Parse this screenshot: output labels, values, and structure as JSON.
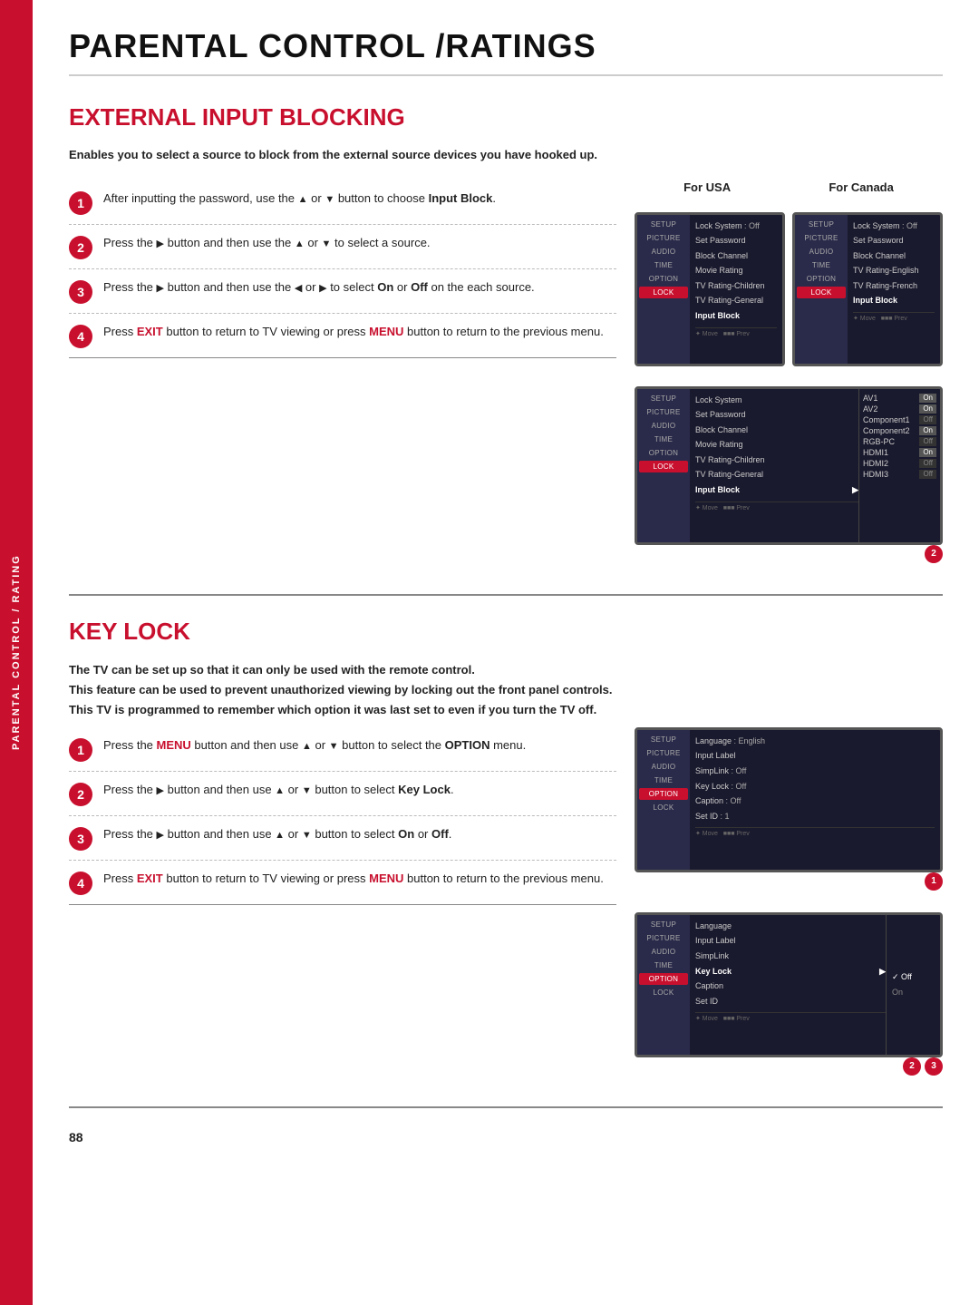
{
  "page": {
    "title": "PARENTAL CONTROL /RATINGS",
    "page_number": "88"
  },
  "side_tab": {
    "label": "PARENTAL CONTROL / RATING"
  },
  "section1": {
    "title": "EXTERNAL INPUT BLOCKING",
    "intro": "Enables you to select a source to block from the external source devices you have hooked up.",
    "steps": [
      {
        "num": "1",
        "text": "After inputting the password, use the ▲ or ▼ button to choose ",
        "bold": "Input Block",
        "text2": "."
      },
      {
        "num": "2",
        "text": "Press the ▶ button and then use the ▲ or ▼ to select a source."
      },
      {
        "num": "3",
        "text": "Press the ▶ button and then use the ◀ or ▶ to select ",
        "bold1": "On",
        "text_mid": " or ",
        "bold2": "Off",
        "text2": " on the each source."
      },
      {
        "num": "4",
        "text": "Press ",
        "bold1": "EXIT",
        "text_mid": " button to return to TV viewing or press ",
        "bold2": "MENU",
        "text2": " button to return to the previous menu."
      }
    ],
    "for_usa_label": "For USA",
    "for_canada_label": "For Canada",
    "screen1_usa": {
      "sidebar": [
        "SETUP",
        "PICTURE",
        "AUDIO",
        "TIME",
        "OPTION",
        "LOCK"
      ],
      "menu_items": [
        {
          "label": "Lock System",
          "val": ": Off"
        },
        {
          "label": "Set Password"
        },
        {
          "label": "Block Channel"
        },
        {
          "label": "Movie Rating"
        },
        {
          "label": "TV Rating-Children"
        },
        {
          "label": "TV Rating-General"
        },
        {
          "label": "Input Block",
          "highlighted": true
        }
      ]
    },
    "screen1_canada": {
      "sidebar": [
        "SETUP",
        "PICTURE",
        "AUDIO",
        "TIME",
        "OPTION",
        "LOCK"
      ],
      "menu_items": [
        {
          "label": "Lock System",
          "val": ": Off"
        },
        {
          "label": "Set Password"
        },
        {
          "label": "Block Channel"
        },
        {
          "label": "TV Rating-English"
        },
        {
          "label": "TV Rating-French"
        },
        {
          "label": "Input Block",
          "highlighted": true
        }
      ]
    },
    "screen2": {
      "sidebar": [
        "SETUP",
        "PICTURE",
        "AUDIO",
        "TIME",
        "OPTION",
        "LOCK"
      ],
      "menu_items": [
        {
          "label": "Lock System"
        },
        {
          "label": "Set Password"
        },
        {
          "label": "Block Channel"
        },
        {
          "label": "Movie Rating"
        },
        {
          "label": "TV Rating-Children"
        },
        {
          "label": "TV Rating-General"
        },
        {
          "label": "Input Block",
          "highlighted": true,
          "arrow": true
        }
      ],
      "sub_items": [
        {
          "label": "AV1",
          "val": "On"
        },
        {
          "label": "AV2",
          "val": "On"
        },
        {
          "label": "Component1",
          "val": "Off"
        },
        {
          "label": "Component2",
          "val": "On"
        },
        {
          "label": "RGB-PC",
          "val": "Off"
        },
        {
          "label": "HDMI1",
          "val": "On"
        },
        {
          "label": "HDMI2",
          "val": "Off"
        },
        {
          "label": "HDMI3",
          "val": "Off"
        }
      ]
    },
    "badge1": "2"
  },
  "section2": {
    "title": "KEY LOCK",
    "intro_lines": [
      "The TV can be set up so that it can only be used with the remote control.",
      "This feature can be used to prevent unauthorized viewing by locking out the front panel controls.",
      "This TV is programmed to remember which option it was last set to even if you turn the TV off."
    ],
    "steps": [
      {
        "num": "1",
        "text": "Press the ",
        "bold1": "MENU",
        "text_mid": " button and then use ▲ or ▼ button to select the ",
        "bold2": "OPTION",
        "text2": " menu."
      },
      {
        "num": "2",
        "text": "Press the ▶ button and then use ▲ or ▼ button to select ",
        "bold": "Key Lock",
        "text2": "."
      },
      {
        "num": "3",
        "text": "Press the ▶ button and then use ▲ or ▼ button to select ",
        "bold1": "On",
        "text_mid": " or ",
        "bold2": "Off",
        "text2": "."
      },
      {
        "num": "4",
        "text": "Press ",
        "bold1": "EXIT",
        "text_mid": " button to return to TV viewing or press ",
        "bold2": "MENU",
        "text2": " button to return to the previous menu."
      }
    ],
    "screen_option": {
      "sidebar": [
        "SETUP",
        "PICTURE",
        "AUDIO",
        "TIME",
        "OPTION",
        "LOCK"
      ],
      "menu_items": [
        {
          "label": "Language",
          "val": ": English"
        },
        {
          "label": "Input Label"
        },
        {
          "label": "SimpLink",
          "val": ": Off"
        },
        {
          "label": "Key Lock",
          "val": ": Off",
          "highlighted": false
        },
        {
          "label": "Caption",
          "val": ": Off"
        },
        {
          "label": "Set ID",
          "val": ": 1"
        }
      ]
    },
    "screen_keylock": {
      "sidebar": [
        "SETUP",
        "PICTURE",
        "AUDIO",
        "TIME",
        "OPTION",
        "LOCK"
      ],
      "menu_items": [
        {
          "label": "Language"
        },
        {
          "label": "Input Label"
        },
        {
          "label": "SimpLink"
        },
        {
          "label": "Key Lock",
          "highlighted": true,
          "arrow": true
        },
        {
          "label": "Caption"
        },
        {
          "label": "Set ID"
        }
      ],
      "sub_items": [
        {
          "label": "✓ Off",
          "selected": true
        },
        {
          "label": "On"
        }
      ]
    },
    "badge_option": "1",
    "badge_keylock1": "2",
    "badge_keylock2": "3"
  }
}
